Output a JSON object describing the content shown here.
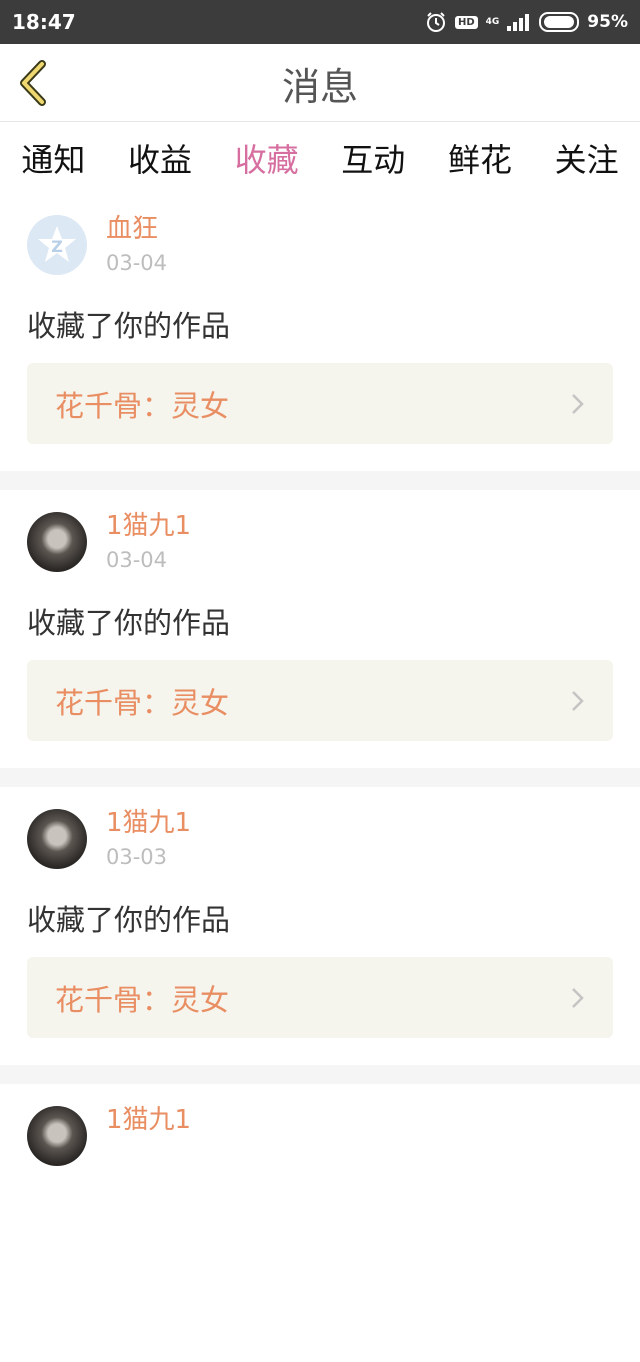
{
  "status_bar": {
    "time": "18:47",
    "hd": "HD",
    "network": "4G",
    "battery_percent": "95%",
    "battery_level": 0.95
  },
  "header": {
    "title": "消息",
    "back_icon": "chevron-left-icon"
  },
  "tabs": [
    {
      "label": "通知",
      "active": false
    },
    {
      "label": "收益",
      "active": false
    },
    {
      "label": "收藏",
      "active": true
    },
    {
      "label": "互动",
      "active": false
    },
    {
      "label": "鲜花",
      "active": false
    },
    {
      "label": "关注",
      "active": false
    }
  ],
  "items": [
    {
      "username": "血狂",
      "date": "03-04",
      "action": "收藏了你的作品",
      "work": "花千骨：灵女",
      "avatar": "qq-default-avatar"
    },
    {
      "username": "1猫九1",
      "date": "03-04",
      "action": "收藏了你的作品",
      "work": "花千骨：灵女",
      "avatar": "user-photo-avatar"
    },
    {
      "username": "1猫九1",
      "date": "03-03",
      "action": "收藏了你的作品",
      "work": "花千骨：灵女",
      "avatar": "user-photo-avatar"
    },
    {
      "username": "1猫九1",
      "avatar": "user-photo-avatar"
    }
  ],
  "colors": {
    "accent": "#d66fa0",
    "username": "#e98e62",
    "status_bar": "#3c3c3c",
    "work_box": "#f5f4ed"
  }
}
